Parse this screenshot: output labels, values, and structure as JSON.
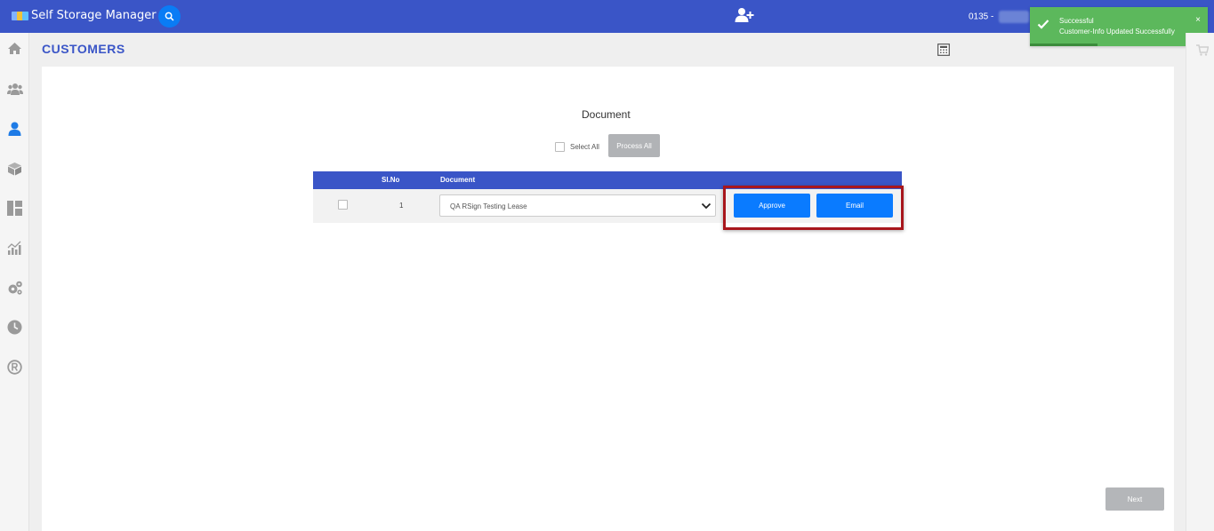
{
  "header": {
    "app_title": "Self Storage Manager",
    "account_prefix": "0135 - ",
    "search_icon": "search-icon",
    "add_user_icon": "user-plus-icon"
  },
  "toast": {
    "title": "Successful",
    "message": "Customer-Info Updated Successfully",
    "close": "×",
    "color": "#5cb85c"
  },
  "sidebar": {
    "items": [
      {
        "icon": "home-icon"
      },
      {
        "icon": "users-icon"
      },
      {
        "icon": "user-icon",
        "active": true
      },
      {
        "icon": "box-icon"
      },
      {
        "icon": "dashboard-icon"
      },
      {
        "icon": "chart-icon"
      },
      {
        "icon": "settings-icon"
      },
      {
        "icon": "clock-icon"
      },
      {
        "icon": "registered-icon"
      }
    ]
  },
  "page": {
    "title": "CUSTOMERS",
    "calculator_icon": "calculator-icon"
  },
  "document": {
    "title": "Document",
    "select_all_label": "Select All",
    "process_all_label": "Process All",
    "table": {
      "headers": [
        "Sl.No",
        "Document"
      ],
      "rows": [
        {
          "sl_no": "1",
          "document": "QA RSign Testing Lease",
          "approve": "Approve",
          "email": "Email"
        }
      ]
    },
    "next_label": "Next"
  },
  "colors": {
    "header_bg": "#3a55c7",
    "primary_button": "#0a7bff",
    "highlight_border": "#a8161c"
  }
}
